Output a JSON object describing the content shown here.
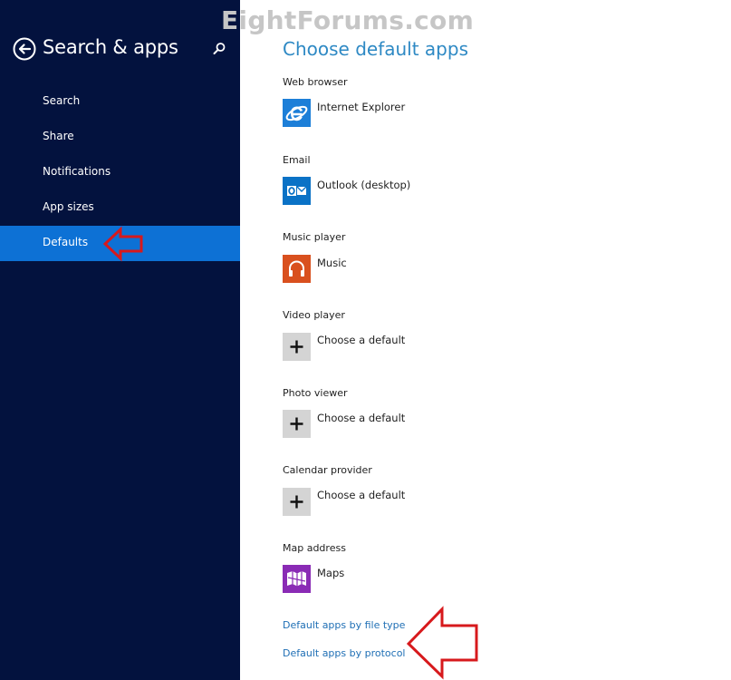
{
  "watermark": "EightForums.com",
  "sidebar": {
    "title": "Search & apps",
    "items": [
      {
        "label": "Search"
      },
      {
        "label": "Share"
      },
      {
        "label": "Notifications"
      },
      {
        "label": "App sizes"
      },
      {
        "label": "Defaults",
        "active": true
      }
    ]
  },
  "main": {
    "title": "Choose default apps",
    "categories": [
      {
        "label": "Web browser",
        "app": "Internet Explorer",
        "icon": "internet-explorer-icon"
      },
      {
        "label": "Email",
        "app": "Outlook (desktop)",
        "icon": "outlook-icon"
      },
      {
        "label": "Music player",
        "app": "Music",
        "icon": "headphones-icon"
      },
      {
        "label": "Video player",
        "app": "Choose a default",
        "icon": "plus-icon"
      },
      {
        "label": "Photo viewer",
        "app": "Choose a default",
        "icon": "plus-icon"
      },
      {
        "label": "Calendar provider",
        "app": "Choose a default",
        "icon": "plus-icon"
      },
      {
        "label": "Map address",
        "app": "Maps",
        "icon": "maps-icon"
      }
    ],
    "links": [
      {
        "label": "Default apps by file type"
      },
      {
        "label": "Default apps by protocol"
      }
    ]
  },
  "colors": {
    "sidebar_bg": "#03123e",
    "sidebar_active": "#0d71d5",
    "title_blue": "#2e89c4",
    "link_blue": "#1f6fb5",
    "ie_blue": "#1d7fd8",
    "outlook_blue": "#0a72c6",
    "music_orange": "#d9501e",
    "maps_purple": "#8a2bb5",
    "annotation_red": "#d7191c"
  }
}
